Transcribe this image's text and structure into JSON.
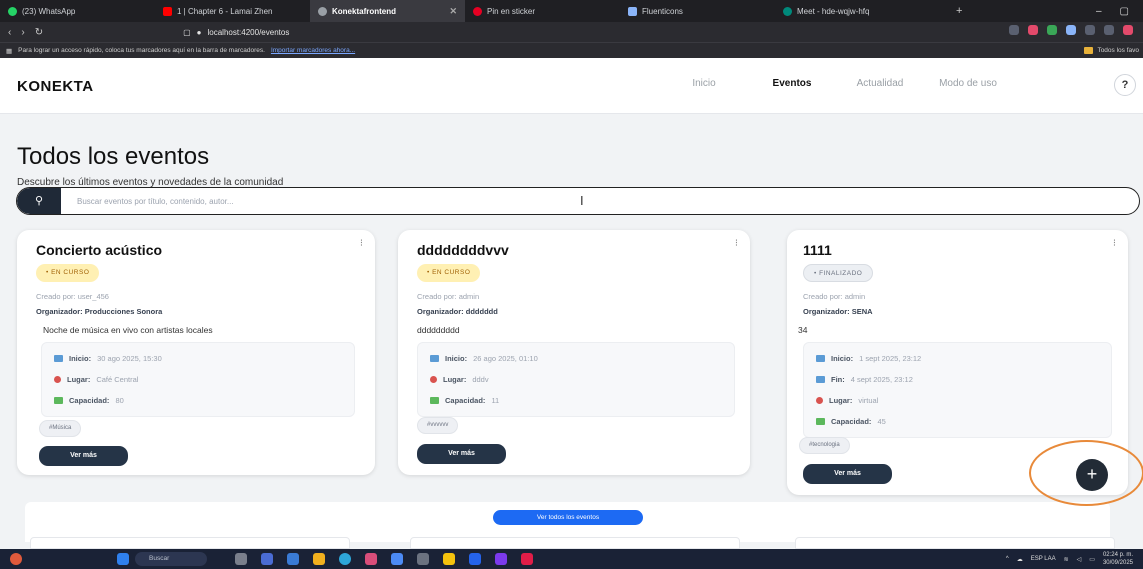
{
  "browser": {
    "tabs": [
      {
        "label": "(23) WhatsApp",
        "icon": "whatsapp-icon",
        "color": "#25d366"
      },
      {
        "label": "1 | Chapter 6 - Lamai Zhen",
        "icon": "youtube-icon",
        "color": "#ff0000"
      },
      {
        "label": "Konektafrontend",
        "icon": "angular-icon",
        "color": "#9aa0a6",
        "active": true
      },
      {
        "label": "Pin en sticker",
        "icon": "pinterest-icon",
        "color": "#e60023"
      },
      {
        "label": "Fluenticons",
        "icon": "fluent-icon",
        "color": "#8ab4f8"
      },
      {
        "label": "Meet - hde-wqjw-hfq",
        "icon": "meet-icon",
        "color": "#00897b"
      }
    ],
    "url": "localhost:4200/eventos",
    "bookmark_prompt": "Para lograr un acceso rápido, coloca tus marcadores aquí en la barra de marcadores.",
    "bookmark_link": "Importar marcadores ahora...",
    "bookmarks_folder": "Todos los favo"
  },
  "app": {
    "brand": "KONEKTA",
    "nav": [
      "Inicio",
      "Eventos",
      "Actualidad",
      "Modo de uso"
    ],
    "help": "?"
  },
  "page": {
    "title": "Todos los eventos",
    "subtitle": "Descubre los últimos eventos y novedades de la comunidad",
    "search_placeholder": "Buscar eventos por título, contenido, autor..."
  },
  "events": [
    {
      "title": "Concierto acústico",
      "status": "• EN CURSO",
      "created_by": "Creado por: user_456",
      "organizer_label": "Organizador:",
      "organizer": "Producciones Sonora",
      "description": "Noche de música en vivo con artistas locales",
      "details": [
        {
          "label": "Inicio:",
          "value": "30 ago 2025, 15:30",
          "icon": "calendar-icon"
        },
        {
          "label": "Lugar:",
          "value": "Café Central",
          "icon": "location-icon"
        },
        {
          "label": "Capacidad:",
          "value": "80",
          "icon": "people-icon"
        }
      ],
      "tag": "#Música",
      "button": "Ver más"
    },
    {
      "title": "ddddddddvvv",
      "status": "• EN CURSO",
      "created_by": "Creado por: admin",
      "organizer_label": "Organizador:",
      "organizer": "ddddddd",
      "description": "ddddddddd",
      "details": [
        {
          "label": "Inicio:",
          "value": "26 ago 2025, 01:10",
          "icon": "calendar-icon"
        },
        {
          "label": "Lugar:",
          "value": "dddv",
          "icon": "location-icon"
        },
        {
          "label": "Capacidad:",
          "value": "11",
          "icon": "people-icon"
        }
      ],
      "tag": "#vvvvvv",
      "button": "Ver más"
    },
    {
      "title": "1111",
      "status": "• FINALIZADO",
      "created_by": "Creado por: admin",
      "organizer_label": "Organizador:",
      "organizer": "SENA",
      "description": "34",
      "details": [
        {
          "label": "Inicio:",
          "value": "1 sept 2025, 23:12",
          "icon": "calendar-icon"
        },
        {
          "label": "Fin:",
          "value": "4 sept 2025, 23:12",
          "icon": "calendar-icon"
        },
        {
          "label": "Lugar:",
          "value": "virtual",
          "icon": "location-icon"
        },
        {
          "label": "Capacidad:",
          "value": "45",
          "icon": "people-icon"
        }
      ],
      "tag": "#tecnologia",
      "button": "Ver más"
    }
  ],
  "view_all": "Ver todos los eventos",
  "fab": "+",
  "colors": {
    "primary_dark": "#253447",
    "accent_blue": "#1d6af3",
    "badge_active_bg": "#fff0b3",
    "annotation_ring": "#e88a3a"
  },
  "taskbar": {
    "search": "Buscar",
    "lang": "ESP LAA",
    "time": "02:24 p. m.",
    "date": "30/09/2025"
  }
}
